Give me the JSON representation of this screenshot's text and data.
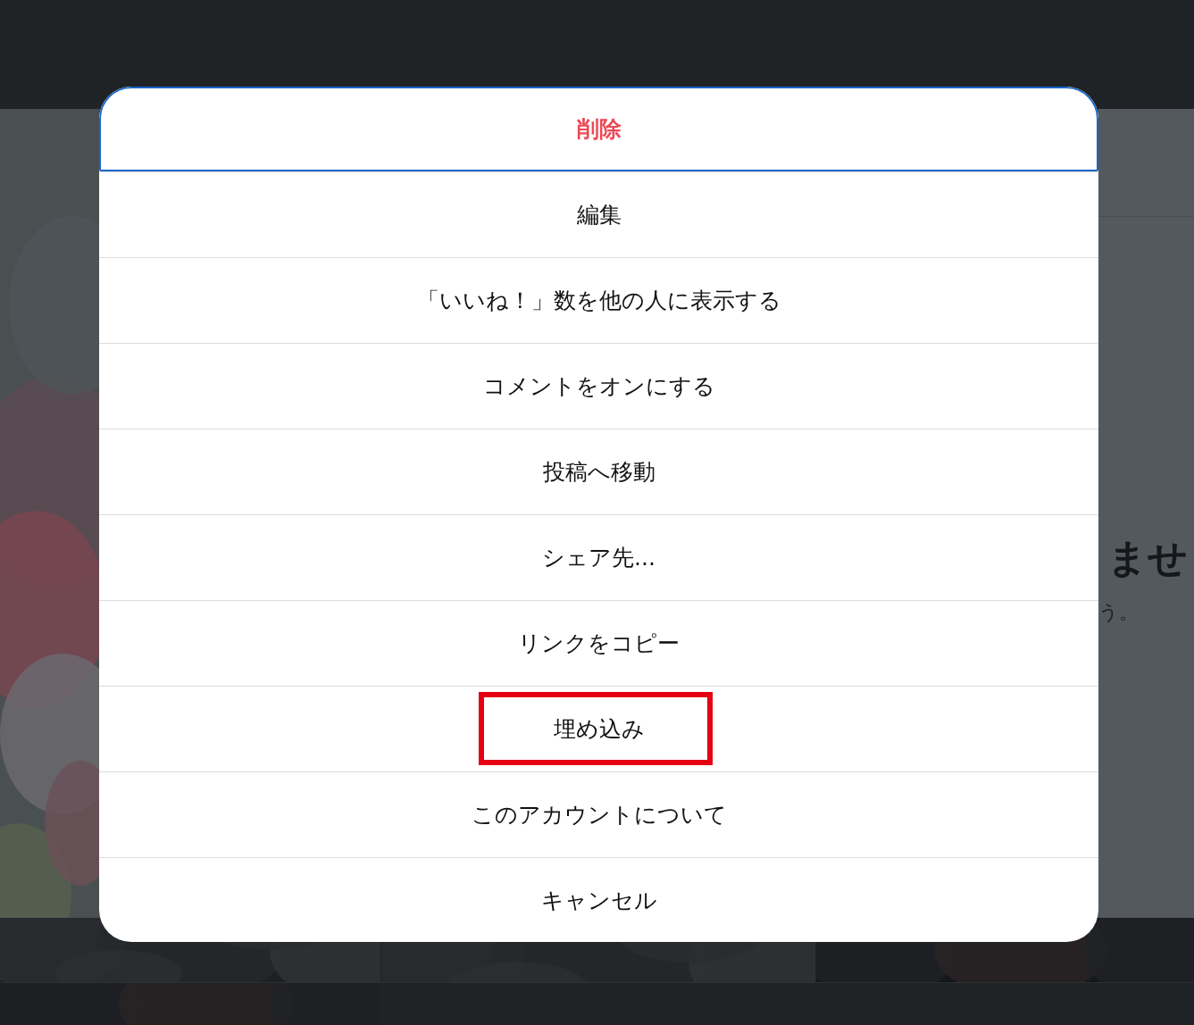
{
  "background": {
    "heading_fragment": "ませ",
    "text_fragment": "う。"
  },
  "menu": {
    "items": [
      {
        "label": "削除",
        "kind": "destructive",
        "focused": true,
        "highlighted": false
      },
      {
        "label": "編集",
        "kind": "normal",
        "focused": false,
        "highlighted": false
      },
      {
        "label": "「いいね！」数を他の人に表示する",
        "kind": "normal",
        "focused": false,
        "highlighted": false
      },
      {
        "label": "コメントをオンにする",
        "kind": "normal",
        "focused": false,
        "highlighted": false
      },
      {
        "label": "投稿へ移動",
        "kind": "normal",
        "focused": false,
        "highlighted": false
      },
      {
        "label": "シェア先...",
        "kind": "normal",
        "focused": false,
        "highlighted": false
      },
      {
        "label": "リンクをコピー",
        "kind": "normal",
        "focused": false,
        "highlighted": false
      },
      {
        "label": "埋め込み",
        "kind": "normal",
        "focused": false,
        "highlighted": true
      },
      {
        "label": "このアカウントについて",
        "kind": "normal",
        "focused": false,
        "highlighted": false
      },
      {
        "label": "キャンセル",
        "kind": "normal",
        "focused": false,
        "highlighted": false
      }
    ]
  }
}
